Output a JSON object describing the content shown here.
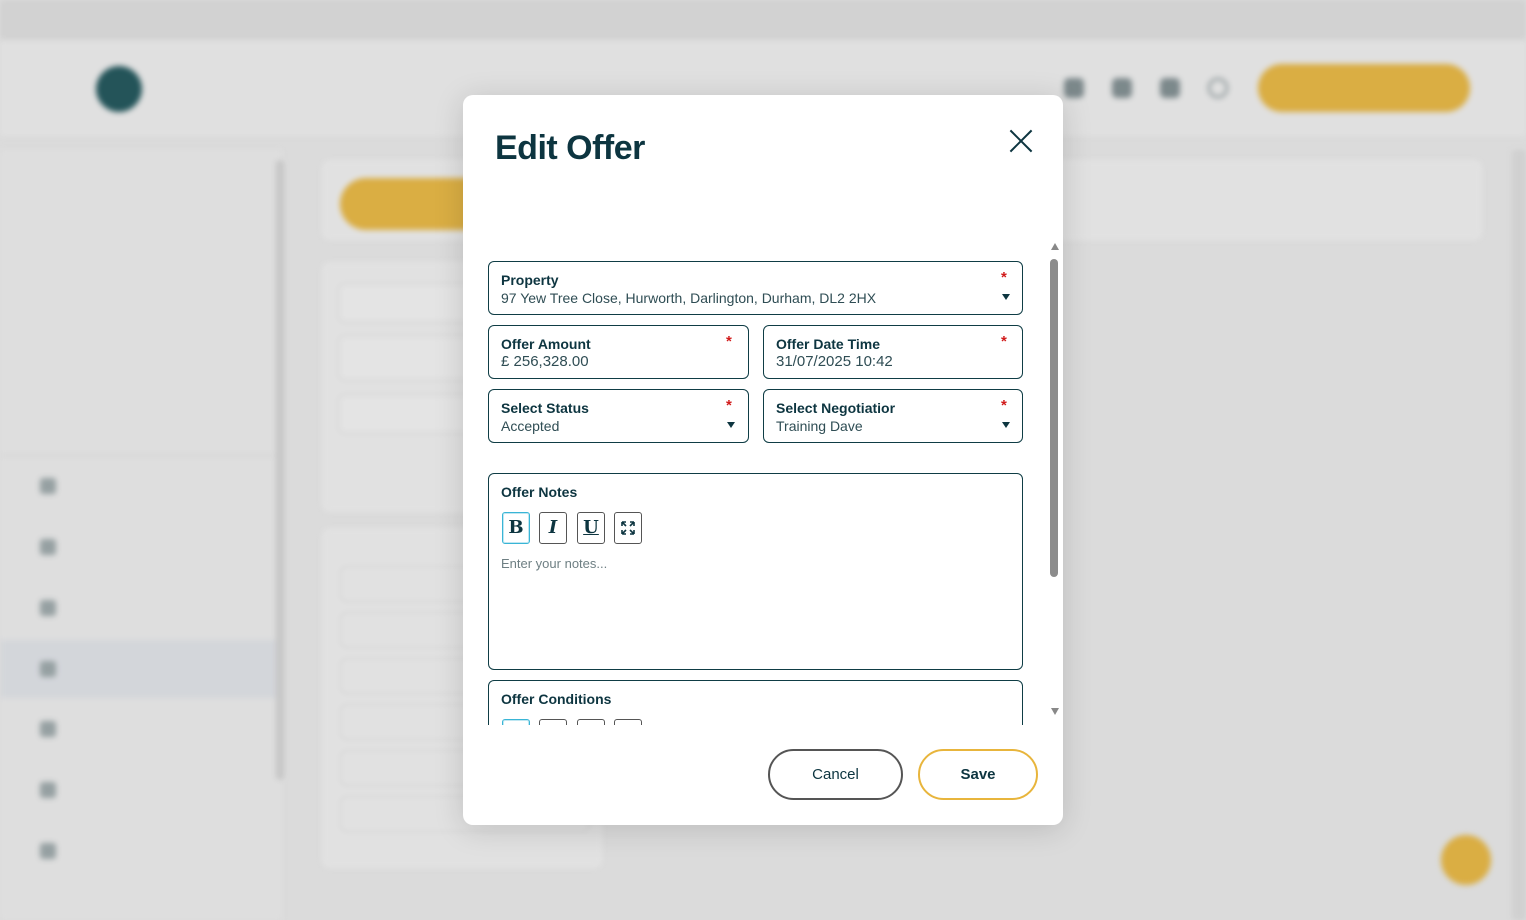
{
  "modal": {
    "title": "Edit Offer",
    "close_label": "×",
    "fields": {
      "property": {
        "label": "Property",
        "value": "97 Yew Tree Close, Hurworth, Darlington, Durham, DL2 2HX",
        "required_mark": "*"
      },
      "offer_amount": {
        "label": "Offer Amount",
        "value": "£ 256,328.00",
        "required_mark": "*"
      },
      "offer_date_time": {
        "label": "Offer Date Time",
        "value": "31/07/2025 10:42",
        "required_mark": "*"
      },
      "status": {
        "label": "Select Status",
        "value": "Accepted",
        "required_mark": "*"
      },
      "negotiator": {
        "label": "Select Negotiatior",
        "value": "Training Dave",
        "required_mark": "*"
      },
      "offer_notes": {
        "label": "Offer Notes",
        "placeholder": "Enter your notes...",
        "toolbar": {
          "bold": "B",
          "italic": "I",
          "underline": "U",
          "expand_icon": "expand-icon"
        }
      },
      "offer_conditions": {
        "label": "Offer Conditions"
      }
    },
    "buttons": {
      "cancel": "Cancel",
      "save": "Save"
    }
  },
  "colors": {
    "primary": "#0d3540",
    "accent": "#e8b53c",
    "required": "#d11a1a",
    "active_toolbar": "#39b5d6"
  },
  "background_icons": [
    "logo",
    "grid-icon",
    "calendar-icon",
    "bell-icon",
    "search-icon",
    "user-icon"
  ]
}
